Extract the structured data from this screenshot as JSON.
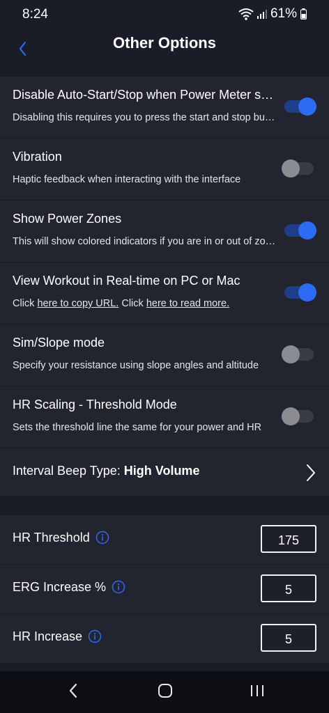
{
  "status": {
    "time": "8:24",
    "battery": "61%"
  },
  "header": {
    "title": "Other Options"
  },
  "toggles": [
    {
      "title": "Disable Auto-Start/Stop when Power Meter stops",
      "desc": "Disabling this requires you to press the start and stop buttons",
      "state": "on"
    },
    {
      "title": "Vibration",
      "desc": "Haptic feedback when interacting with the interface",
      "state": "off"
    },
    {
      "title": "Show Power Zones",
      "desc": "This will show colored indicators if you are in or out of zone",
      "state": "on"
    },
    {
      "title": "View Workout in Real-time on PC or Mac",
      "state": "on"
    },
    {
      "title": "Sim/Slope mode",
      "desc": "Specify your resistance using slope angles and altitude",
      "state": "off"
    },
    {
      "title": "HR Scaling - Threshold Mode",
      "desc": "Sets the threshold line the same for your power and HR",
      "state": "off"
    }
  ],
  "realtime": {
    "click_a": "Click ",
    "link_copy": "here to copy URL.",
    "click_b": " Click ",
    "link_read": "here to read more."
  },
  "interval_beep": {
    "label": "Interval Beep Type: ",
    "value": "High Volume"
  },
  "numbers": [
    {
      "label": "HR Threshold",
      "value": "175"
    },
    {
      "label": "ERG Increase %",
      "value": "5"
    },
    {
      "label": "HR Increase",
      "value": "5"
    }
  ],
  "colors": {
    "accent": "#2c6bf2",
    "background": "#1a1c28",
    "row": "#22252f"
  },
  "icons": {
    "back": "chevron-left-icon",
    "info": "info-icon",
    "nav_home": "home-icon"
  }
}
